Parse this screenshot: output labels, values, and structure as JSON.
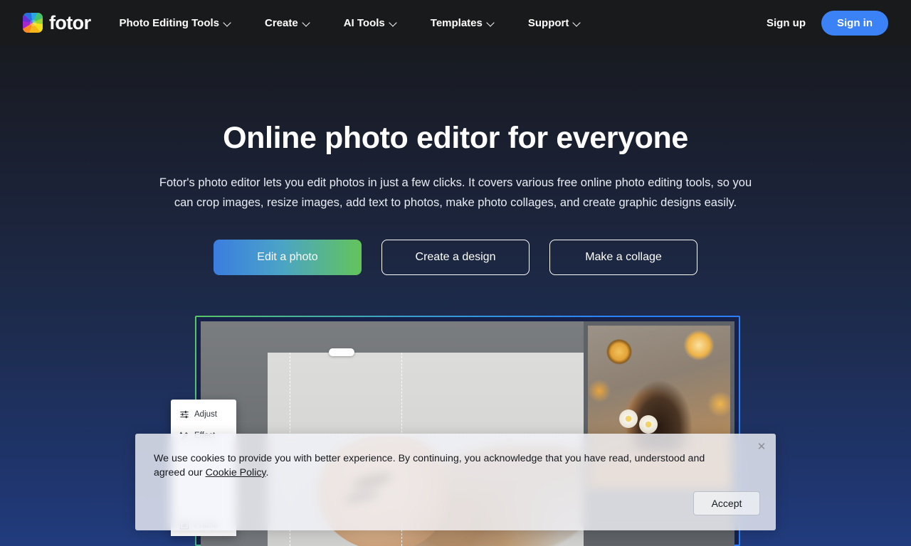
{
  "navbar": {
    "brand": {
      "name": "fotor",
      "icon": "fotor-logo-icon"
    },
    "links": [
      {
        "label": "Photo Editing Tools",
        "has_dropdown": true
      },
      {
        "label": "Create",
        "has_dropdown": true
      },
      {
        "label": "AI Tools",
        "has_dropdown": true
      },
      {
        "label": "Templates",
        "has_dropdown": true
      },
      {
        "label": "Support",
        "has_dropdown": true
      }
    ],
    "sign_up": "Sign up",
    "sign_in": "Sign in",
    "background": "#191a1c",
    "sign_in_color": "#3b82f6"
  },
  "hero": {
    "title": "Online photo editor for everyone",
    "subtitle": "Fotor's photo editor lets you edit photos in just a few clicks. It covers various free online photo editing tools, so you can crop images, resize images, add text to photos, make photo collages, and create graphic designs easily.",
    "buttons": [
      {
        "label": "Edit a photo",
        "style": "gradient"
      },
      {
        "label": "Create a design",
        "style": "outline"
      },
      {
        "label": "Make a collage",
        "style": "outline"
      }
    ],
    "gradient_from": "#3b7de0",
    "gradient_to": "#63c45a"
  },
  "editor_mock": {
    "frame_gradient_from": "#58c766",
    "frame_gradient_to": "#2b7fff",
    "tool_panel": [
      {
        "label": "Adjust",
        "icon": "sliders-icon"
      },
      {
        "label": "Effect",
        "icon": "magic-wand-icon"
      },
      {
        "label": "Frame",
        "icon": "frame-icon"
      }
    ]
  },
  "cookie_banner": {
    "text_before_link": "We use cookies to provide you with better experience. By continuing, you acknowledge that you have read, understood and agreed our ",
    "link_label": "Cookie Policy",
    "text_after_link": ".",
    "accept_label": "Accept",
    "close_icon": "close-icon"
  }
}
